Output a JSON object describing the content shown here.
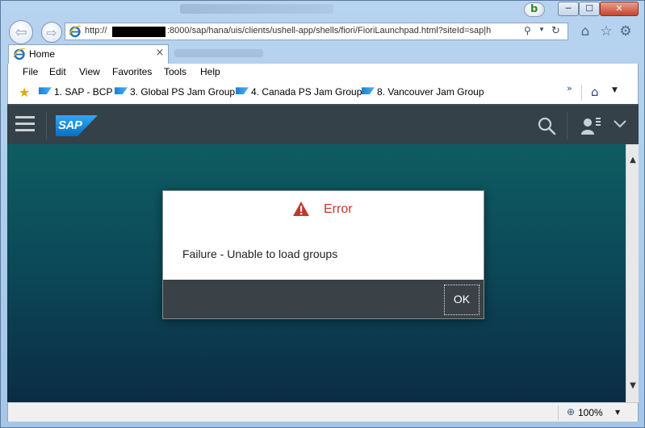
{
  "browser": {
    "address": {
      "prefix": "http://",
      "rest": ":8000/sap/hana/uis/clients/ushell-app/shells/fiori/FioriLaunchpad.html?siteId=sap|h"
    },
    "tab": {
      "title": "Home",
      "close_glyph": "×"
    },
    "window_buttons": {
      "minimize": "─",
      "maximize": "☐",
      "close": "✕"
    },
    "badge_letter": "b",
    "menu": [
      "File",
      "Edit",
      "View",
      "Favorites",
      "Tools",
      "Help"
    ],
    "favorites": [
      "1. SAP - BCP",
      "3. Global PS Jam Group",
      "4. Canada PS Jam Group",
      "8. Vancouver Jam Group"
    ],
    "favorites_more": "»",
    "zoom": "100%"
  },
  "app": {
    "logo_text": "SAP"
  },
  "dialog": {
    "title": "Error",
    "message": "Failure - Unable to load groups",
    "ok_label": "OK"
  },
  "colors": {
    "error_red": "#c0392b",
    "shell_bar": "#344149",
    "dialog_footer": "#3b4247",
    "sap_blue": "#0a6ec7"
  },
  "icons": {
    "back": "back-arrow-icon",
    "forward": "forward-arrow-icon",
    "home": "home-icon",
    "favorites": "star-icon",
    "tools": "gear-icon",
    "search": "search-icon",
    "user": "user-icon",
    "warning": "warning-triangle-icon"
  }
}
